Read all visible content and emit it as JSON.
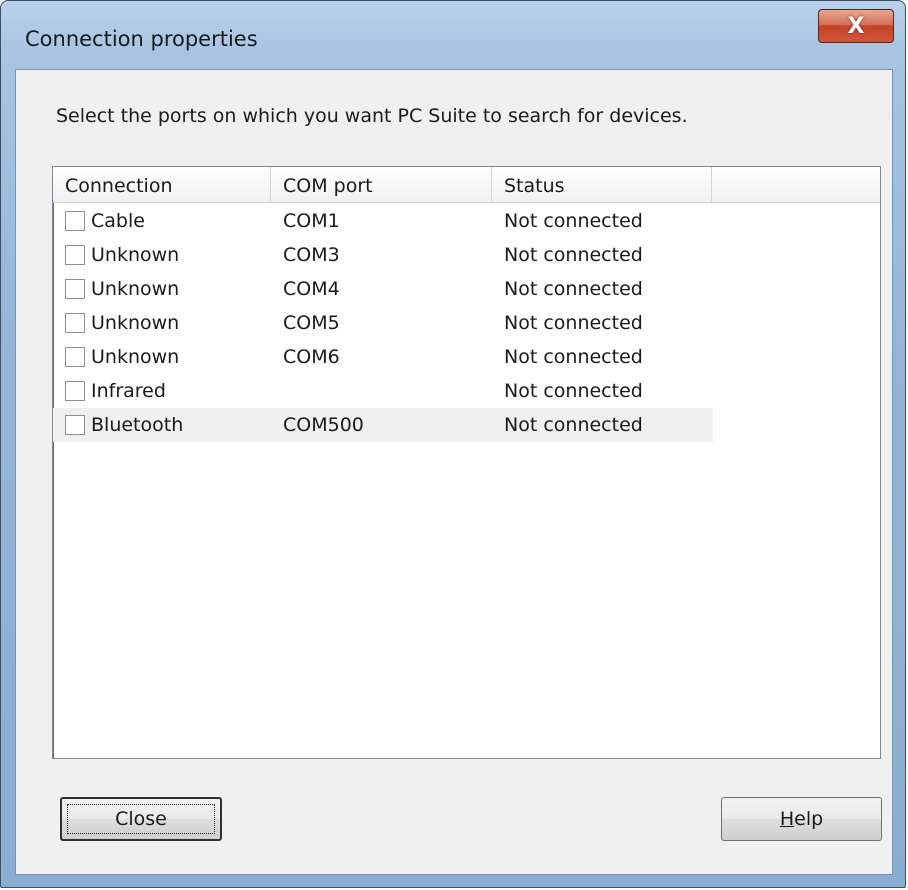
{
  "window": {
    "title": "Connection properties",
    "close_glyph": "X"
  },
  "instruction": "Select the ports on which you want PC Suite to search for devices.",
  "table": {
    "columns": [
      "Connection",
      "COM port",
      "Status"
    ],
    "rows": [
      {
        "connection": "Cable",
        "com_port": "COM1",
        "status": "Not connected",
        "checked": false
      },
      {
        "connection": "Unknown",
        "com_port": "COM3",
        "status": "Not connected",
        "checked": false
      },
      {
        "connection": "Unknown",
        "com_port": "COM4",
        "status": "Not connected",
        "checked": false
      },
      {
        "connection": "Unknown",
        "com_port": "COM5",
        "status": "Not connected",
        "checked": false
      },
      {
        "connection": "Unknown",
        "com_port": "COM6",
        "status": "Not connected",
        "checked": false
      },
      {
        "connection": "Infrared",
        "com_port": "",
        "status": "Not connected",
        "checked": false
      },
      {
        "connection": "Bluetooth",
        "com_port": "COM500",
        "status": "Not connected",
        "checked": false
      }
    ],
    "selected_row": 6
  },
  "buttons": {
    "close_label": "Close",
    "help_mnemonic": "H",
    "help_rest": "elp"
  }
}
